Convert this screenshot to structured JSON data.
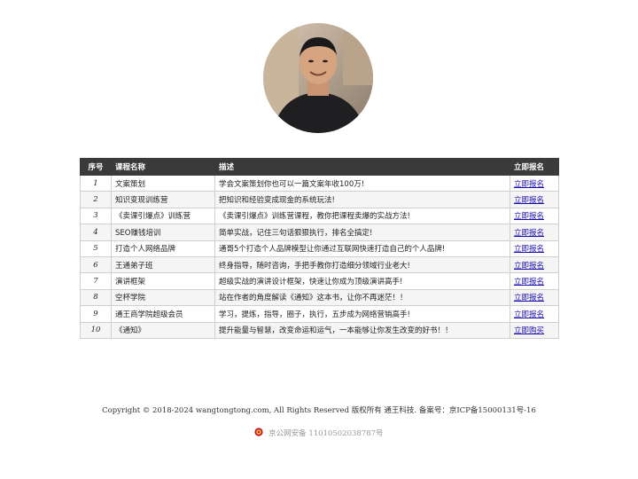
{
  "table": {
    "headers": [
      "序号",
      "课程名称",
      "描述",
      "立即报名"
    ],
    "rows": [
      {
        "idx": "1",
        "name": "文案策划",
        "desc": "学会文案策划你也可以一篇文案年收100万!",
        "action": "立即报名"
      },
      {
        "idx": "2",
        "name": "知识变现训练营",
        "desc": "把知识和经验变成现金的系统玩法!",
        "action": "立即报名"
      },
      {
        "idx": "3",
        "name": "《卖课引爆点》训练营",
        "desc": "《卖课引爆点》训练营课程，教你把课程卖爆的实战方法!",
        "action": "立即报名"
      },
      {
        "idx": "4",
        "name": "SEO赚钱培训",
        "desc": "简单实战，记住三句话狠狠执行，排名全搞定!",
        "action": "立即报名"
      },
      {
        "idx": "5",
        "name": "打造个人网络品牌",
        "desc": "通哥5个打造个人品牌模型让你通过互联网快速打造自己的个人品牌!",
        "action": "立即报名"
      },
      {
        "idx": "6",
        "name": "王通弟子班",
        "desc": "终身指导，随时咨询，手把手教你打造细分领域行业老大!",
        "action": "立即报名"
      },
      {
        "idx": "7",
        "name": "演讲框架",
        "desc": "超级实战的演讲设计框架，快速让你成为顶级演讲高手!",
        "action": "立即报名"
      },
      {
        "idx": "8",
        "name": "空杯学院",
        "desc": "站在作者的角度解读《通知》这本书，让你不再迷茫！！",
        "action": "立即报名"
      },
      {
        "idx": "9",
        "name": "通王商学院超级会员",
        "desc": "学习，提炼，指导，圈子，执行，五步成为网络营销高手!",
        "action": "立即报名"
      },
      {
        "idx": "10",
        "name": "《通知》",
        "desc": "提升能量与智慧，改变命运和运气，一本能够让你发生改变的好书！！",
        "action": "立即购买"
      }
    ]
  },
  "footer": {
    "copyright": "Copyright © 2018-2024 wangtongtong.com, All Rights Reserved 版权所有 通王科技. 备案号：京ICP备15000131号-16",
    "police_record": "京公网安备 11010502038787号"
  },
  "colors": {
    "header_bg": "#3a3a3a",
    "link": "#1a0dab",
    "border": "#cfcfcf"
  }
}
